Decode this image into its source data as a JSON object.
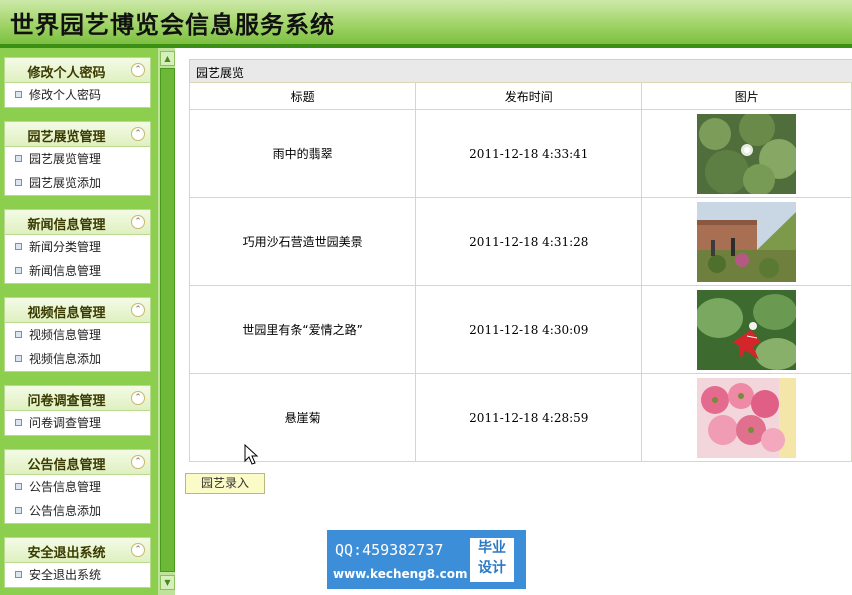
{
  "header": {
    "title": "世界园艺博览会信息服务系统"
  },
  "sidebar": {
    "panels": [
      {
        "title": "修改个人密码",
        "items": [
          "修改个人密码"
        ]
      },
      {
        "title": "园艺展览管理",
        "items": [
          "园艺展览管理",
          "园艺展览添加"
        ]
      },
      {
        "title": "新闻信息管理",
        "items": [
          "新闻分类管理",
          "新闻信息管理"
        ]
      },
      {
        "title": "视频信息管理",
        "items": [
          "视频信息管理",
          "视频信息添加"
        ]
      },
      {
        "title": "问卷调查管理",
        "items": [
          "问卷调查管理"
        ]
      },
      {
        "title": "公告信息管理",
        "items": [
          "公告信息管理",
          "公告信息添加"
        ]
      },
      {
        "title": "安全退出系统",
        "items": [
          "安全退出系统"
        ]
      }
    ],
    "collapse_icon": "⌃"
  },
  "main": {
    "section_title": "园艺展览",
    "columns": [
      "标题",
      "发布时间",
      "图片"
    ],
    "rows": [
      {
        "title": "雨中的翡翠",
        "time": "2011-12-18 4:33:41",
        "image": "lotus-leaves"
      },
      {
        "title": "巧用沙石营造世园美景",
        "time": "2011-12-18 4:31:28",
        "image": "garden-scene"
      },
      {
        "title": "世园里有条“爱情之路”",
        "time": "2011-12-18 4:30:09",
        "image": "red-flower"
      },
      {
        "title": "悬崖菊",
        "time": "2011-12-18 4:28:59",
        "image": "pink-chrysanthemum"
      }
    ],
    "add_button": "园艺录入"
  },
  "watermark": {
    "qq": "QQ:459382737",
    "url": "www.kecheng8.com",
    "badge_line1": "毕业",
    "badge_line2": "设计"
  }
}
